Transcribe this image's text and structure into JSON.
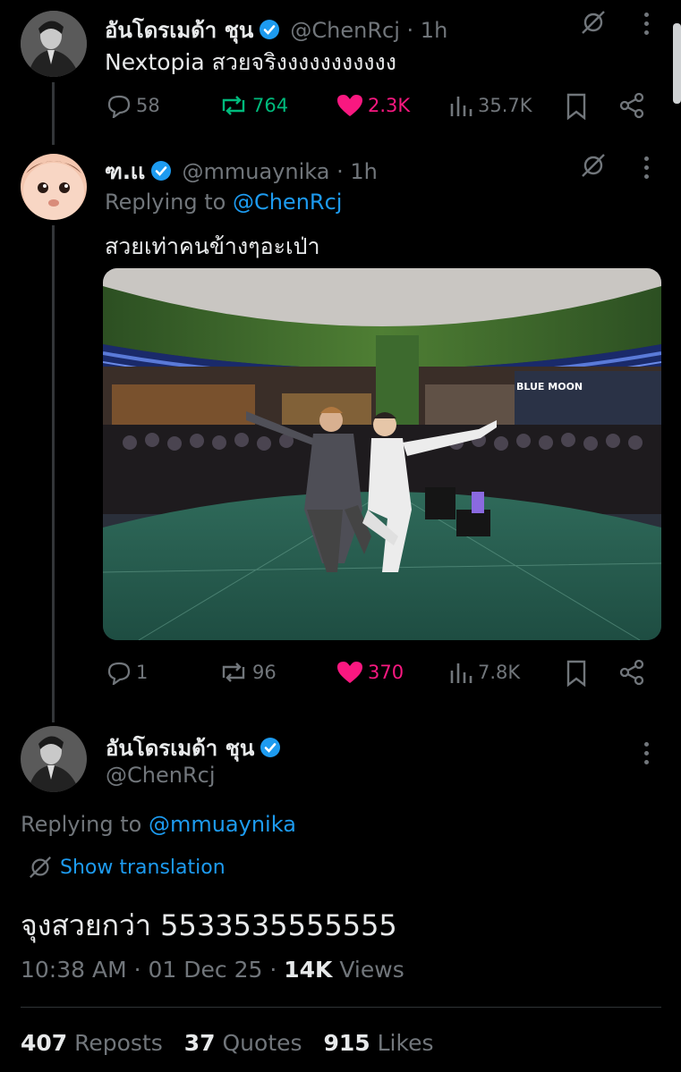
{
  "tweet1": {
    "name": "อันโดรเมด้า ชุน",
    "handle": "@ChenRcj · 1h",
    "text": "Nextopia สวยจริงงงงงงงงงงง",
    "replies": "58",
    "reposts": "764",
    "likes": "2.3K",
    "views": "35.7K"
  },
  "tweet2": {
    "name": "ฑ.เเ",
    "handle": "@mmuaynika · 1h",
    "replying_prefix": "Replying to",
    "replying_to": "@ChenRcj",
    "text": "สวยเท่าคนข้างๆอะเป่า",
    "image_sign": "BLUE MOON",
    "replies": "1",
    "reposts": "96",
    "likes": "370",
    "views": "7.8K"
  },
  "main_tweet": {
    "name": "อันโดรเมด้า ชุน",
    "handle": "@ChenRcj",
    "replying_prefix": "Replying to",
    "replying_to": "@mmuaynika",
    "show_translation": "Show translation",
    "text": "จุงสวยกว่า 5533535555555",
    "timestamp": "10:38 AM · 01 Dec 25 ·",
    "views_count": "14K",
    "views_label": "Views",
    "reposts_count": "407",
    "reposts_label": "Reposts",
    "quotes_count": "37",
    "quotes_label": "Quotes",
    "likes_count": "915",
    "likes_label": "Likes"
  },
  "colors": {
    "background": "#000000",
    "text": "#e7e9ea",
    "muted": "#71767b",
    "link": "#1d9bf0",
    "like": "#f91880",
    "repost": "#00ba7c"
  }
}
